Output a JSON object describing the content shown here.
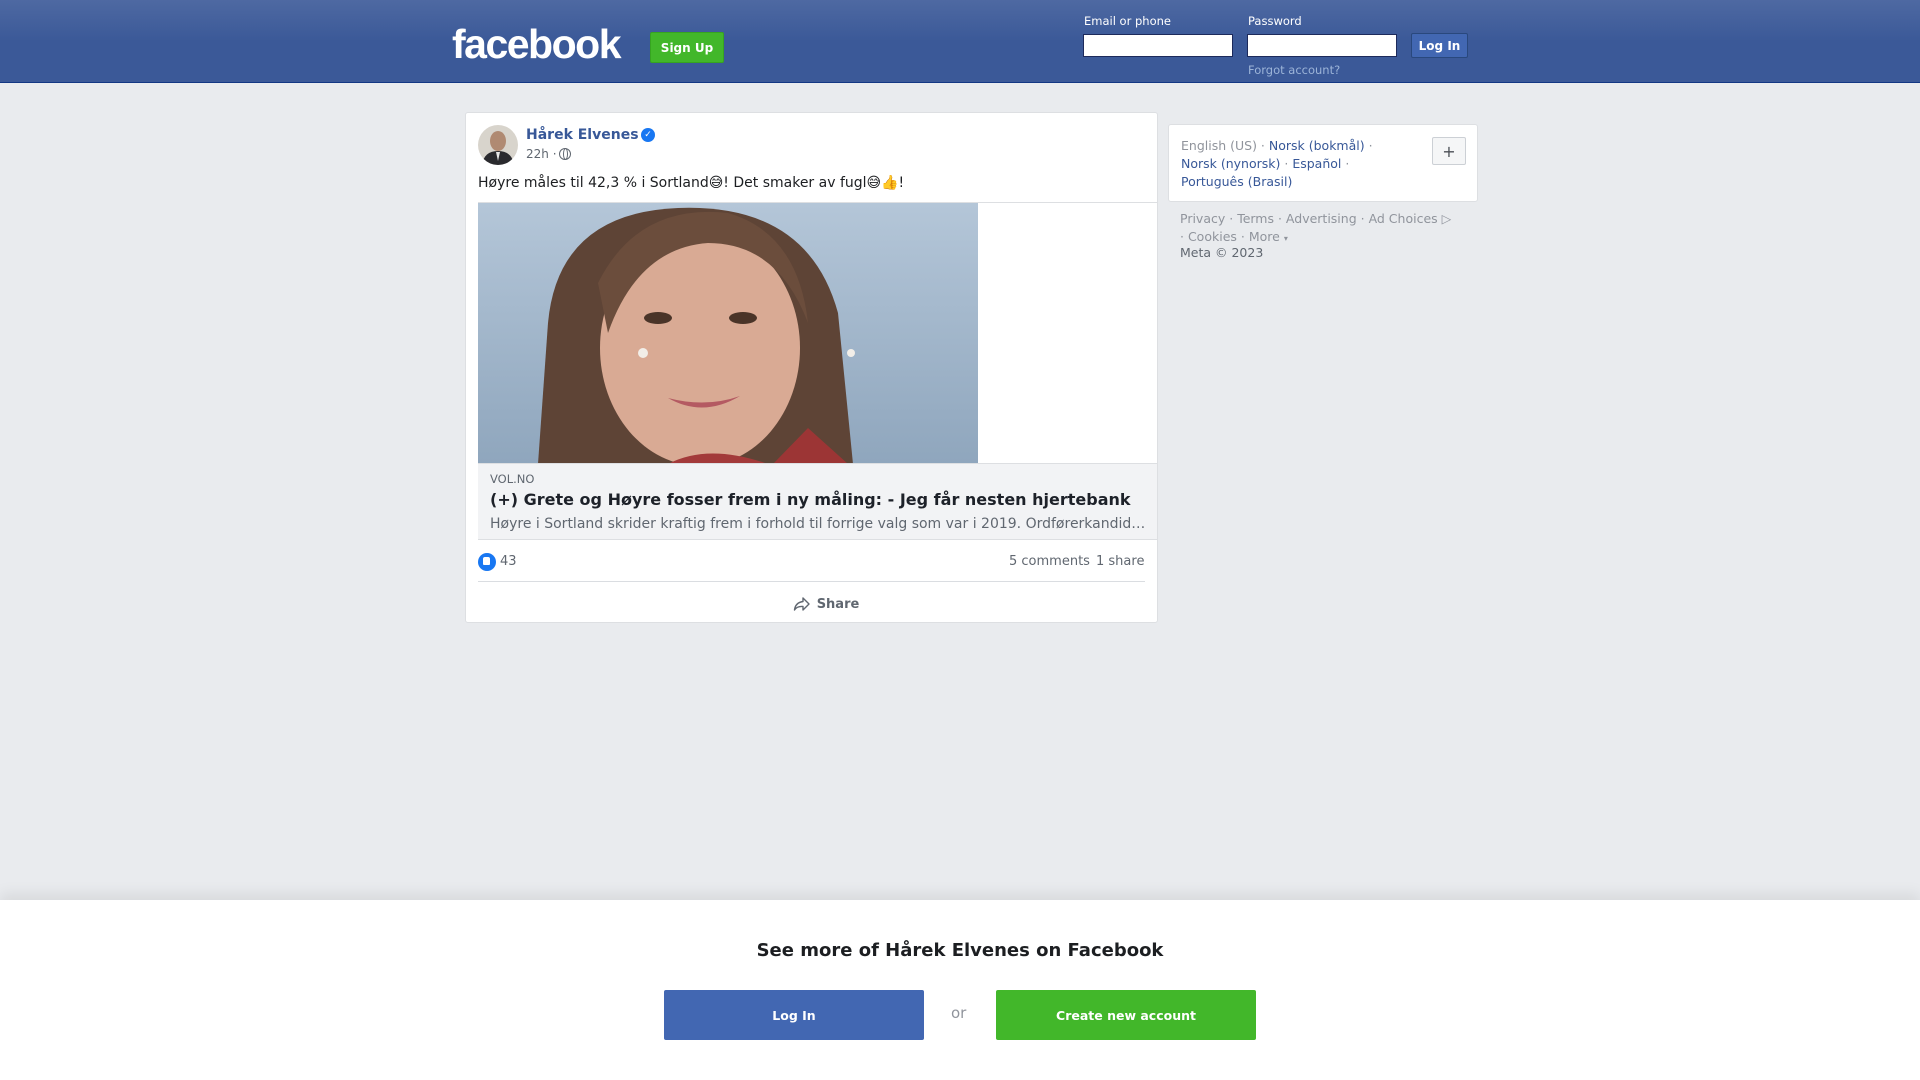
{
  "header": {
    "logo": "facebook",
    "signup_label": "Sign Up",
    "email_label": "Email or phone",
    "password_label": "Password",
    "login_label": "Log In",
    "forgot_label": "Forgot account?"
  },
  "post": {
    "author": "Hårek Elvenes",
    "time": "22h ·",
    "text": "Høyre måles til 42,3 % i Sortland😅! Det smaker av fugl😅👍!",
    "link": {
      "domain": "VOL.NO",
      "title": "(+) Grete og Høyre fosser frem i ny måling: - Jeg får nesten hjertebank",
      "description": "Høyre i Sortland skrider kraftig frem i forhold til forrige valg som var i 2019. Ordførerkandidat Grete..."
    },
    "likes": "43",
    "comments": "5 comments",
    "shares": "1 share",
    "share_label": "Share"
  },
  "sidebar": {
    "languages": {
      "current": "English (US)",
      "items": [
        "Norsk (bokmål)",
        "Norsk (nynorsk)",
        "Español",
        "Português (Brasil)"
      ],
      "more_label": "+"
    },
    "footer_links": [
      "Privacy",
      "Terms",
      "Advertising",
      "Ad Choices",
      "Cookies",
      "More"
    ],
    "copyright": "Meta © 2023"
  },
  "banner": {
    "title": "See more of Hårek Elvenes on Facebook",
    "login_label": "Log In",
    "or_label": "or",
    "create_label": "Create new account"
  },
  "colors": {
    "brand_blue": "#3b5998",
    "button_blue": "#4267b2",
    "green": "#42b72a"
  },
  "icons": [
    "verified-badge-icon",
    "globe-icon",
    "like-icon",
    "share-icon",
    "ad-choices-icon",
    "caret-down-icon"
  ]
}
